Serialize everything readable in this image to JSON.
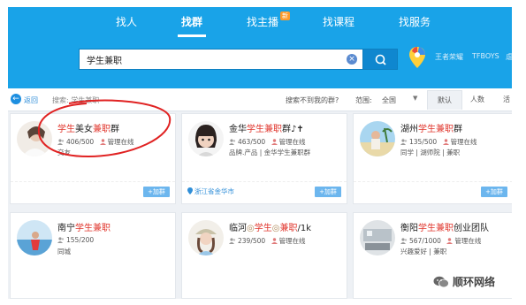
{
  "nav": {
    "items": [
      "找人",
      "找群",
      "找主播",
      "找课程",
      "找服务"
    ],
    "active_index": 1,
    "badge": "新"
  },
  "search": {
    "value": "学生兼职",
    "clear_glyph": "×",
    "hot_words": [
      "王者荣耀",
      "TFBOYS",
      "虐"
    ]
  },
  "filter": {
    "back_glyph": "←",
    "back_label": "返回",
    "query_label": "搜索: 学生兼职",
    "not_found": "搜索不到我的群?",
    "range_label": "范围:",
    "range_value": "全国",
    "sort_tabs": [
      "默认",
      "人数",
      "活"
    ],
    "sort_active": 0
  },
  "cards": [
    {
      "name_pre": "",
      "name_hl": "学生",
      "name_mid": "美女",
      "name_hl2": "兼职",
      "name_post": "群",
      "members": "406/500",
      "admin": "管理在线",
      "tags": "交友",
      "location": "",
      "add": "+加群",
      "avatar": "girl-white"
    },
    {
      "name_pre": "金华",
      "name_hl": "学生兼职",
      "name_mid": "",
      "name_hl2": "",
      "name_post": "群♪✝",
      "members": "463/500",
      "admin": "管理在线",
      "tags": "品牌.产品 | 金华学生兼职群",
      "location": "浙江省金华市",
      "add": "+加群",
      "avatar": "child"
    },
    {
      "name_pre": "湖州",
      "name_hl": "学生兼职",
      "name_mid": "",
      "name_hl2": "",
      "name_post": "群",
      "members": "135/500",
      "admin": "管理在线",
      "tags": "同学 | 湖师院 | 兼职",
      "location": "",
      "add": "+加群",
      "avatar": "beach"
    },
    {
      "name_pre": "南宁",
      "name_hl": "学生兼职",
      "name_mid": "",
      "name_hl2": "",
      "name_post": "",
      "members": "155/200",
      "admin": "",
      "tags": "同城",
      "location": "",
      "add": "",
      "avatar": "sea"
    },
    {
      "name_pre": "临河",
      "name_hl": "学生",
      "name_mid": "",
      "name_hl2": "兼职",
      "name_post": "/1k",
      "members": "239/500",
      "admin": "管理在线",
      "tags": "",
      "location": "",
      "add": "",
      "avatar": "girl-hat"
    },
    {
      "name_pre": "衡阳",
      "name_hl": "学生兼职",
      "name_mid": "",
      "name_hl2": "",
      "name_post": "创业团队",
      "members": "567/1000",
      "admin": "管理在线",
      "tags": "兴趣爱好 | 兼职",
      "location": "",
      "add": "",
      "avatar": "room"
    }
  ],
  "watermark": "顺环网络",
  "colors": {
    "brand": "#19a3e8",
    "highlight": "#e0342b",
    "annotation": "#e02222"
  }
}
